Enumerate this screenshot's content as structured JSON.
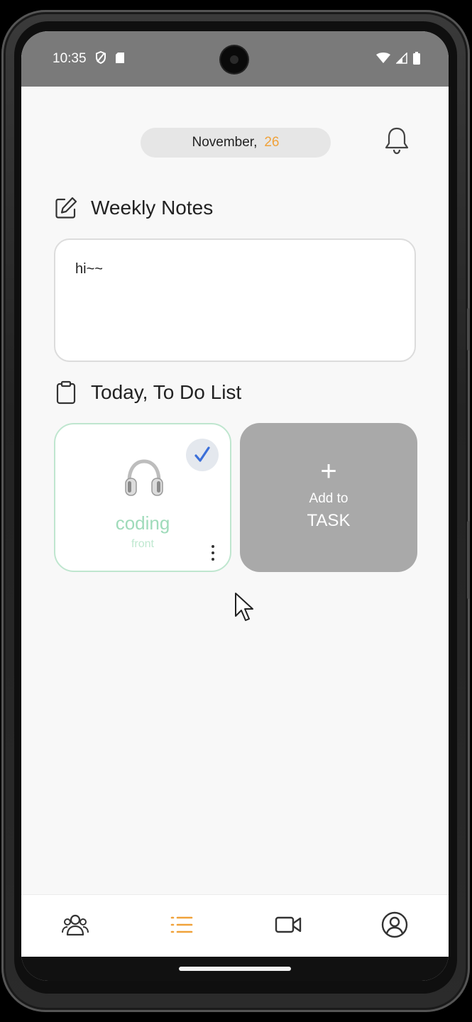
{
  "status_bar": {
    "time": "10:35"
  },
  "header": {
    "month": "November,",
    "day": "26"
  },
  "notes": {
    "title": "Weekly Notes",
    "content": "hi~~"
  },
  "todo": {
    "title": "Today, To Do List",
    "tasks": [
      {
        "title": "coding",
        "subtitle": "front",
        "completed": true
      }
    ],
    "add_card": {
      "plus": "+",
      "line1": "Add to",
      "line2": "TASK"
    }
  },
  "bottom_nav": {
    "items": [
      {
        "icon": "people-icon",
        "active": false
      },
      {
        "icon": "list-icon",
        "active": true
      },
      {
        "icon": "video-camera-icon",
        "active": false
      },
      {
        "icon": "profile-icon",
        "active": false
      }
    ]
  },
  "colors": {
    "accent": "#f0a23a",
    "task_green": "#9fdbba",
    "add_card_gray": "#a9a9a9"
  }
}
